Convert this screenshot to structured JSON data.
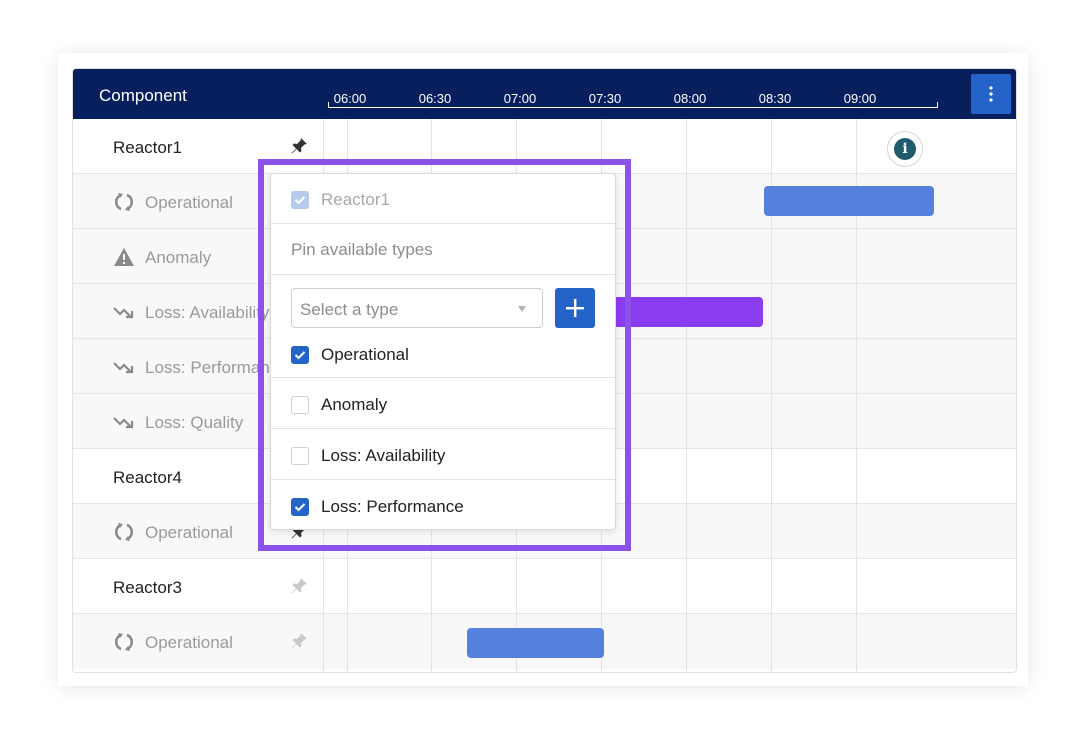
{
  "header": {
    "title": "Component",
    "ticks": [
      "06:00",
      "06:30",
      "07:00",
      "07:30",
      "08:00",
      "08:30",
      "09:00"
    ],
    "menu_icon": "vertical-dots-icon",
    "color": "#07205d"
  },
  "rows": [
    {
      "label": "Reactor1",
      "type": "component",
      "pinned": true
    },
    {
      "label": "Operational",
      "type": "sub",
      "icon": "refresh-icon"
    },
    {
      "label": "Anomaly",
      "type": "sub",
      "icon": "warning-icon"
    },
    {
      "label": "Loss: Availability",
      "type": "sub",
      "icon": "trend-down-icon"
    },
    {
      "label": "Loss: Performance",
      "type": "sub",
      "icon": "trend-down-icon"
    },
    {
      "label": "Loss: Quality",
      "type": "sub",
      "icon": "trend-down-icon"
    },
    {
      "label": "Reactor4",
      "type": "component"
    },
    {
      "label": "Operational",
      "type": "sub",
      "icon": "refresh-icon",
      "pinned": true
    },
    {
      "label": "Reactor3",
      "type": "component",
      "pinned": false
    },
    {
      "label": "Operational",
      "type": "sub",
      "icon": "refresh-icon",
      "pinned": false
    }
  ],
  "bars": [
    {
      "row": "Reactor1 Operational",
      "color": "#5680de"
    },
    {
      "row": "Reactor1 Loss: Availability",
      "color": "#8a3cf0"
    },
    {
      "row": "Reactor3 Operational",
      "color": "#5680de"
    }
  ],
  "popover": {
    "component": {
      "label": "Reactor1",
      "checked": true,
      "disabled": true
    },
    "title": "Pin available types",
    "select_placeholder": "Select a type",
    "add_icon": "plus-icon",
    "options": [
      {
        "label": "Operational",
        "checked": true
      },
      {
        "label": "Anomaly",
        "checked": false
      },
      {
        "label": "Loss: Availability",
        "checked": false
      },
      {
        "label": "Loss: Performance",
        "checked": true
      }
    ],
    "highlight_color": "#8a52e6"
  },
  "info_icon": "info-icon"
}
